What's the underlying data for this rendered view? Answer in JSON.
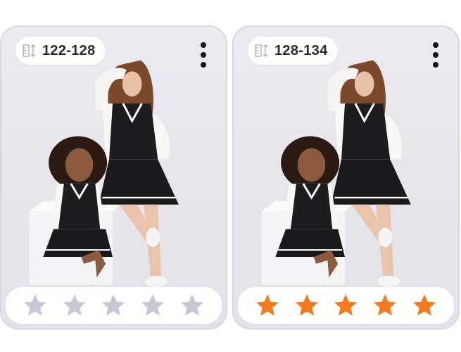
{
  "cards": [
    {
      "size_label": "122-128",
      "rating": {
        "value": 0,
        "max": 5
      },
      "star_color": "#c7c7d6"
    },
    {
      "size_label": "128-134",
      "rating": {
        "value": 5,
        "max": 5
      },
      "star_color": "#f47a1f"
    }
  ],
  "icons": {
    "size_icon": "ruler-height-icon",
    "menu_icon": "more-vertical-icon",
    "star_icon": "star-icon"
  },
  "colors": {
    "card_background": "#e9e8ee",
    "star_active": "#f47a1f",
    "star_inactive": "#c7c7d6"
  }
}
